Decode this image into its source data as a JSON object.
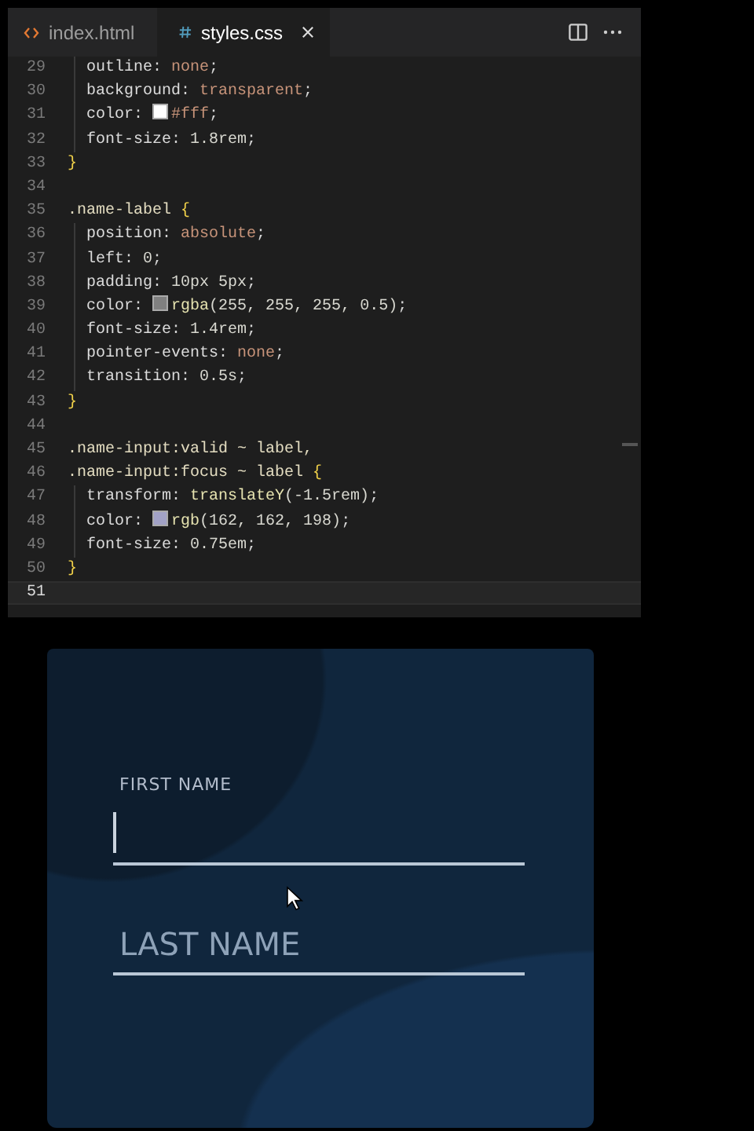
{
  "editor": {
    "tabs": [
      {
        "label": "index.html",
        "kind": "html",
        "selected": false
      },
      {
        "label": "styles.css",
        "kind": "css",
        "selected": true
      }
    ],
    "lines": [
      {
        "number": "29",
        "kind": "decl",
        "current": false,
        "tokens": [
          {
            "text": "outline",
            "kind": "prop"
          },
          {
            "text": ": ",
            "kind": "punct"
          },
          {
            "text": "none",
            "kind": "kw"
          },
          {
            "text": ";",
            "kind": "punct"
          }
        ]
      },
      {
        "number": "30",
        "kind": "decl",
        "current": false,
        "tokens": [
          {
            "text": "background",
            "kind": "prop"
          },
          {
            "text": ": ",
            "kind": "punct"
          },
          {
            "text": "transparent",
            "kind": "kw"
          },
          {
            "text": ";",
            "kind": "punct"
          }
        ]
      },
      {
        "number": "31",
        "kind": "decl",
        "current": false,
        "tokens": [
          {
            "text": "color",
            "kind": "prop"
          },
          {
            "text": ": ",
            "kind": "punct"
          },
          {
            "kind": "swatch",
            "color": "#ffffff"
          },
          {
            "text": "#fff",
            "kind": "kw"
          },
          {
            "text": ";",
            "kind": "punct"
          }
        ]
      },
      {
        "number": "32",
        "kind": "decl",
        "current": false,
        "tokens": [
          {
            "text": "font-size",
            "kind": "prop"
          },
          {
            "text": ": ",
            "kind": "punct"
          },
          {
            "text": "1.8rem",
            "kind": "num"
          },
          {
            "text": ";",
            "kind": "punct"
          }
        ]
      },
      {
        "number": "33",
        "kind": "rule",
        "current": false,
        "tokens": [
          {
            "text": "}",
            "kind": "brace"
          }
        ]
      },
      {
        "number": "34",
        "kind": "rule",
        "current": false
      },
      {
        "number": "35",
        "kind": "rule",
        "current": false,
        "tokens": [
          {
            "text": ".name-label ",
            "kind": "sel"
          },
          {
            "text": "{",
            "kind": "brace"
          }
        ]
      },
      {
        "number": "36",
        "kind": "decl",
        "current": false,
        "tokens": [
          {
            "text": "position",
            "kind": "prop"
          },
          {
            "text": ": ",
            "kind": "punct"
          },
          {
            "text": "absolute",
            "kind": "kw"
          },
          {
            "text": ";",
            "kind": "punct"
          }
        ]
      },
      {
        "number": "37",
        "kind": "decl",
        "current": false,
        "tokens": [
          {
            "text": "left",
            "kind": "prop"
          },
          {
            "text": ": ",
            "kind": "punct"
          },
          {
            "text": "0",
            "kind": "num"
          },
          {
            "text": ";",
            "kind": "punct"
          }
        ]
      },
      {
        "number": "38",
        "kind": "decl",
        "current": false,
        "tokens": [
          {
            "text": "padding",
            "kind": "prop"
          },
          {
            "text": ": ",
            "kind": "punct"
          },
          {
            "text": "10px 5px",
            "kind": "num"
          },
          {
            "text": ";",
            "kind": "punct"
          }
        ]
      },
      {
        "number": "39",
        "kind": "decl",
        "current": false,
        "tokens": [
          {
            "text": "color",
            "kind": "prop"
          },
          {
            "text": ": ",
            "kind": "punct"
          },
          {
            "kind": "swatch",
            "color": "#808080"
          },
          {
            "text": "rgba",
            "kind": "fn"
          },
          {
            "text": "(255, 255, 255, 0.5)",
            "kind": "num"
          },
          {
            "text": ";",
            "kind": "punct"
          }
        ]
      },
      {
        "number": "40",
        "kind": "decl",
        "current": false,
        "tokens": [
          {
            "text": "font-size",
            "kind": "prop"
          },
          {
            "text": ": ",
            "kind": "punct"
          },
          {
            "text": "1.4rem",
            "kind": "num"
          },
          {
            "text": ";",
            "kind": "punct"
          }
        ]
      },
      {
        "number": "41",
        "kind": "decl",
        "current": false,
        "tokens": [
          {
            "text": "pointer-events",
            "kind": "prop"
          },
          {
            "text": ": ",
            "kind": "punct"
          },
          {
            "text": "none",
            "kind": "kw"
          },
          {
            "text": ";",
            "kind": "punct"
          }
        ]
      },
      {
        "number": "42",
        "kind": "decl",
        "current": false,
        "tokens": [
          {
            "text": "transition",
            "kind": "prop"
          },
          {
            "text": ": ",
            "kind": "punct"
          },
          {
            "text": "0.5s",
            "kind": "num"
          },
          {
            "text": ";",
            "kind": "punct"
          }
        ]
      },
      {
        "number": "43",
        "kind": "rule",
        "current": false,
        "tokens": [
          {
            "text": "}",
            "kind": "brace"
          }
        ]
      },
      {
        "number": "44",
        "kind": "rule",
        "current": false
      },
      {
        "number": "45",
        "kind": "rule",
        "current": false,
        "tokens": [
          {
            "text": ".name-input:valid ~ label,",
            "kind": "sel"
          }
        ]
      },
      {
        "number": "46",
        "kind": "rule",
        "current": false,
        "tokens": [
          {
            "text": ".name-input:focus ~ label ",
            "kind": "sel"
          },
          {
            "text": "{",
            "kind": "brace"
          }
        ]
      },
      {
        "number": "47",
        "kind": "decl",
        "current": false,
        "tokens": [
          {
            "text": "transform",
            "kind": "prop"
          },
          {
            "text": ": ",
            "kind": "punct"
          },
          {
            "text": "translateY",
            "kind": "fn"
          },
          {
            "text": "(-1.5rem)",
            "kind": "num"
          },
          {
            "text": ";",
            "kind": "punct"
          }
        ]
      },
      {
        "number": "48",
        "kind": "decl",
        "current": false,
        "tokens": [
          {
            "text": "color",
            "kind": "prop"
          },
          {
            "text": ": ",
            "kind": "punct"
          },
          {
            "kind": "swatch",
            "color": "#a2a2c6"
          },
          {
            "text": "rgb",
            "kind": "fn"
          },
          {
            "text": "(162, 162, 198)",
            "kind": "num"
          },
          {
            "text": ";",
            "kind": "punct"
          }
        ]
      },
      {
        "number": "49",
        "kind": "decl",
        "current": false,
        "tokens": [
          {
            "text": "font-size",
            "kind": "prop"
          },
          {
            "text": ": ",
            "kind": "punct"
          },
          {
            "text": "0.75em",
            "kind": "num"
          },
          {
            "text": ";",
            "kind": "punct"
          }
        ]
      },
      {
        "number": "50",
        "kind": "rule",
        "current": false,
        "tokens": [
          {
            "text": "}",
            "kind": "brace"
          }
        ]
      },
      {
        "number": "51",
        "kind": "rule",
        "current": true
      }
    ]
  },
  "form": {
    "fields": [
      {
        "label": "FIRST NAME",
        "focused": true
      },
      {
        "label": "LAST NAME",
        "focused": false
      }
    ]
  }
}
